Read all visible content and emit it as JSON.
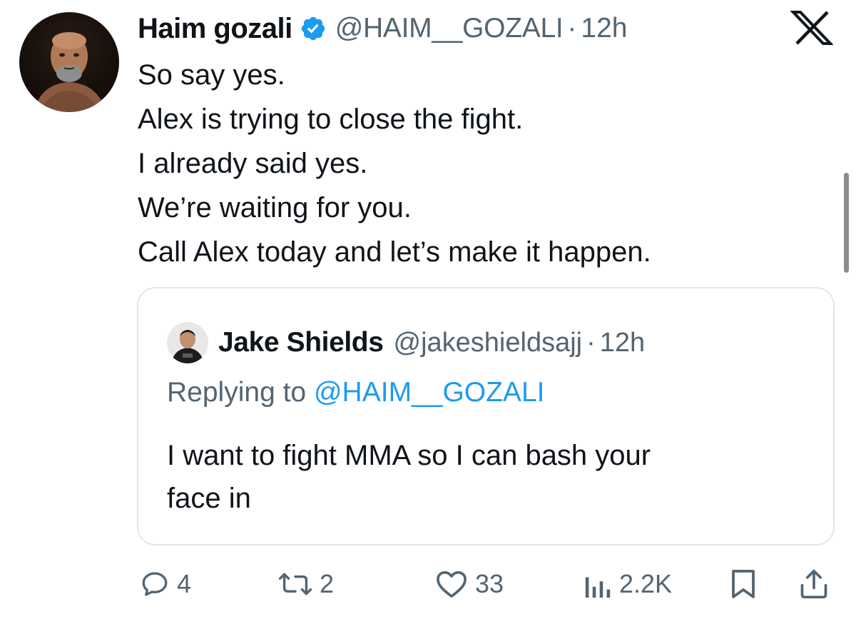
{
  "tweet": {
    "author_name": "Haim gozali",
    "author_handle": "@HAIM__GOZALI",
    "separator": "·",
    "time": "12h",
    "lines": [
      "So say yes.",
      "Alex is trying to close the fight.",
      "I already said yes.",
      "We’re waiting for you.",
      "Call Alex today and let’s make it happen."
    ]
  },
  "quote": {
    "author_name": "Jake Shields",
    "author_handle": "@jakeshieldsajj",
    "separator": "·",
    "time": "12h",
    "replying_prefix": "Replying to",
    "replying_handle": "@HAIM__GOZALI",
    "lines": [
      "I want to fight MMA so I can bash your",
      "face in"
    ]
  },
  "actions": {
    "replies": "4",
    "reposts": "2",
    "likes": "33",
    "views": "2.2K"
  },
  "icons": {
    "verified": "verified-badge-icon",
    "brand": "x-logo-icon",
    "reply": "reply-icon",
    "repost": "repost-icon",
    "like": "heart-icon",
    "views": "views-chart-icon",
    "bookmark": "bookmark-icon",
    "share": "share-icon"
  },
  "colors": {
    "text_primary": "#0f1419",
    "text_secondary": "#536471",
    "accent": "#1d9bf0",
    "card_border": "#e3e7ea"
  }
}
